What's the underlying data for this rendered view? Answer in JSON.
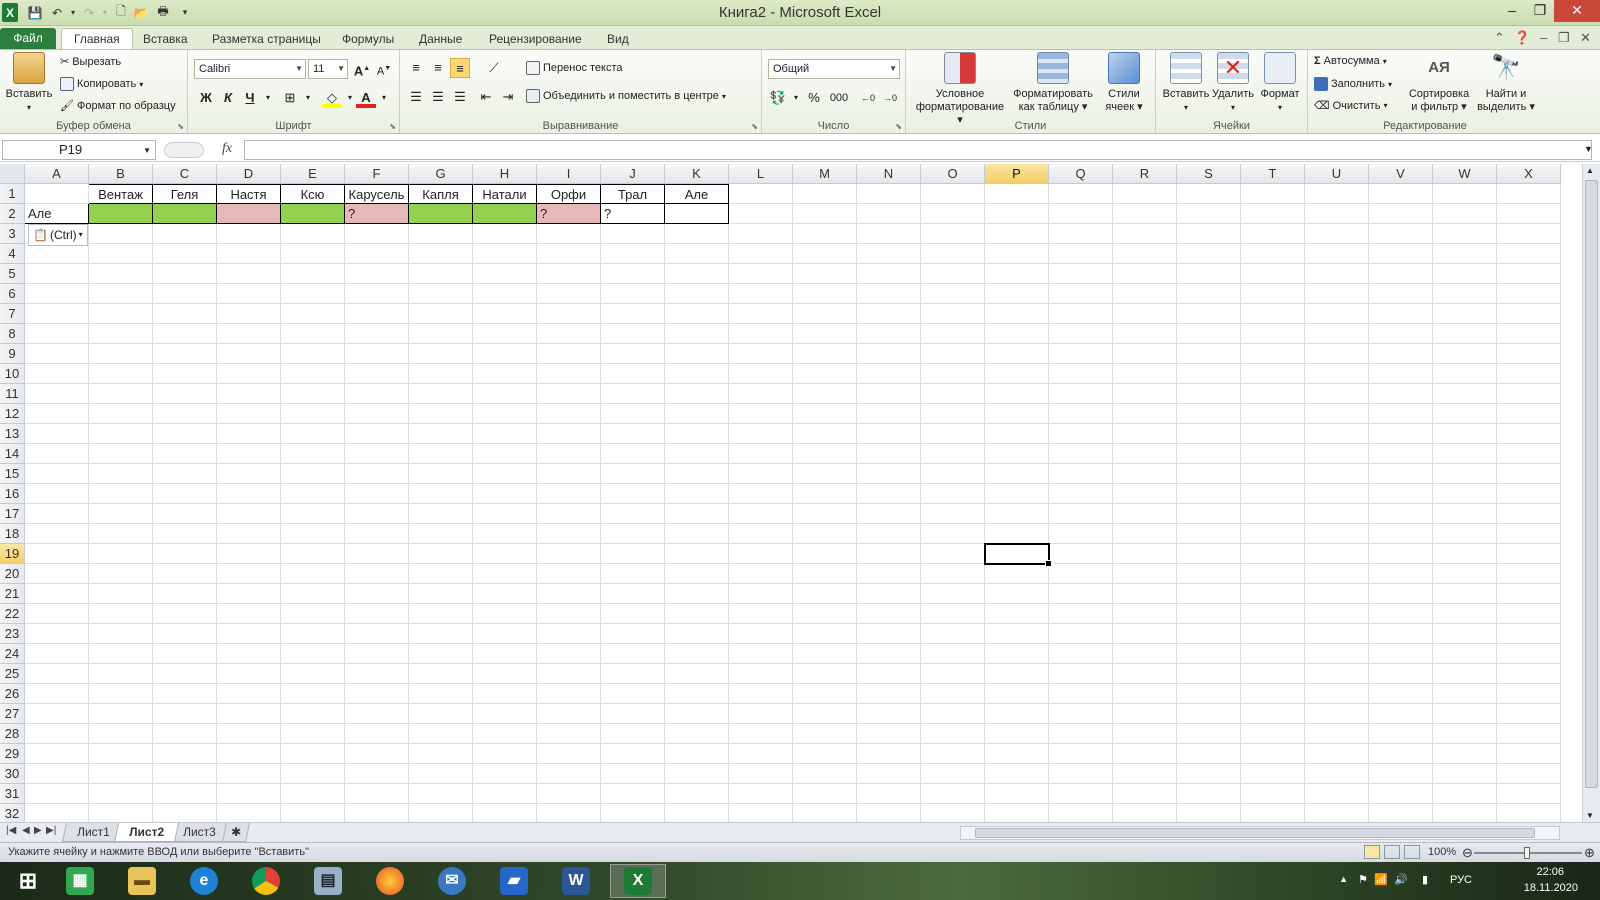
{
  "window": {
    "title": "Книга2 - Microsoft Excel"
  },
  "tabs": [
    "Файл",
    "Главная",
    "Вставка",
    "Разметка страницы",
    "Формулы",
    "Данные",
    "Рецензирование",
    "Вид"
  ],
  "ribbon": {
    "clipboard": {
      "paste": "Вставить",
      "cut": "Вырезать",
      "copy": "Копировать",
      "format_painter": "Формат по образцу",
      "label": "Буфер обмена"
    },
    "font": {
      "name": "Calibri",
      "size": "11",
      "bold": "Ж",
      "italic": "К",
      "underline": "Ч",
      "label": "Шрифт"
    },
    "alignment": {
      "wrap": "Перенос текста",
      "merge": "Объединить и поместить в центре",
      "label": "Выравнивание"
    },
    "number": {
      "format": "Общий",
      "percent": "%",
      "thousands": "000",
      "label": "Число"
    },
    "styles": {
      "conditional": [
        "Условное",
        "форматирование"
      ],
      "as_table": [
        "Форматировать",
        "как таблицу"
      ],
      "cell_styles": [
        "Стили",
        "ячеек"
      ],
      "label": "Стили"
    },
    "cells": {
      "insert": "Вставить",
      "delete": "Удалить",
      "format": "Формат",
      "label": "Ячейки"
    },
    "editing": {
      "autosum": "Автосумма",
      "fill": "Заполнить",
      "clear": "Очистить",
      "sort": [
        "Сортировка",
        "и фильтр"
      ],
      "find": [
        "Найти и",
        "выделить"
      ],
      "label": "Редактирование"
    }
  },
  "formula_bar": {
    "name_box": "P19",
    "fx": "fx",
    "formula": ""
  },
  "columns": [
    "A",
    "B",
    "C",
    "D",
    "E",
    "F",
    "G",
    "H",
    "I",
    "J",
    "K",
    "L",
    "M",
    "N",
    "O",
    "P",
    "Q",
    "R",
    "S",
    "T",
    "U",
    "V",
    "W",
    "X"
  ],
  "selected_column": "P",
  "selected_row": 19,
  "row_count": 32,
  "cells": [
    {
      "ref": "B1",
      "text": "Вентаж"
    },
    {
      "ref": "C1",
      "text": "Геля"
    },
    {
      "ref": "D1",
      "text": "Настя"
    },
    {
      "ref": "E1",
      "text": "Ксю"
    },
    {
      "ref": "F1",
      "text": "Карусель"
    },
    {
      "ref": "G1",
      "text": "Капля"
    },
    {
      "ref": "H1",
      "text": "Натали"
    },
    {
      "ref": "I1",
      "text": "Орфи"
    },
    {
      "ref": "J1",
      "text": "Трал"
    },
    {
      "ref": "K1",
      "text": "Але"
    },
    {
      "ref": "A2",
      "text": "Але"
    },
    {
      "ref": "B2",
      "text": "",
      "fill": "#92d050"
    },
    {
      "ref": "C2",
      "text": "",
      "fill": "#92d050"
    },
    {
      "ref": "D2",
      "text": "",
      "fill": "#e6b8b7"
    },
    {
      "ref": "E2",
      "text": "",
      "fill": "#92d050"
    },
    {
      "ref": "F2",
      "text": "?",
      "fill": "#e6b8b7"
    },
    {
      "ref": "G2",
      "text": "",
      "fill": "#92d050"
    },
    {
      "ref": "H2",
      "text": "",
      "fill": "#92d050"
    },
    {
      "ref": "I2",
      "text": "?",
      "fill": "#e6b8b7"
    },
    {
      "ref": "J2",
      "text": "?"
    },
    {
      "ref": "K2",
      "text": ""
    }
  ],
  "paste_options": {
    "label": "(Ctrl)"
  },
  "sheets": [
    "Лист1",
    "Лист2",
    "Лист3"
  ],
  "active_sheet": "Лист2",
  "status": {
    "message": "Укажите ячейку и нажмите ВВОД или выберите \"Вставить\"",
    "zoom": "100%"
  },
  "taskbar": {
    "lang": "РУС",
    "time": "22:06",
    "date": "18.11.2020"
  }
}
